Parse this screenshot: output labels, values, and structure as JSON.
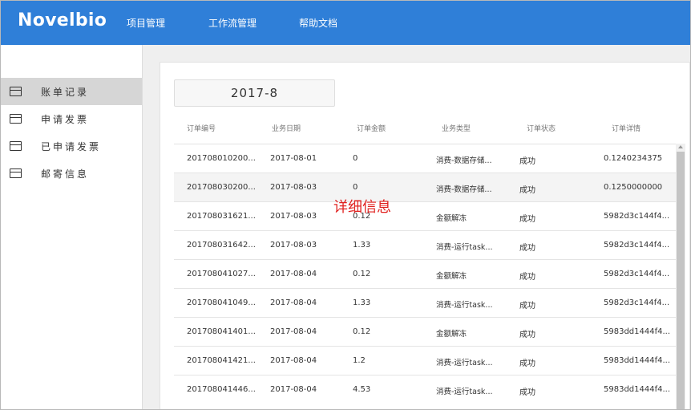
{
  "app": {
    "logo": "Novelbio"
  },
  "nav": {
    "items": [
      "项目管理",
      "工作流管理",
      "帮助文档"
    ]
  },
  "sidebar": {
    "items": [
      {
        "label": "账单记录",
        "icon": "card-icon",
        "active": true
      },
      {
        "label": "申请发票",
        "icon": "card-icon",
        "active": false
      },
      {
        "label": "已申请发票",
        "icon": "card-icon",
        "active": false
      },
      {
        "label": "邮寄信息",
        "icon": "card-icon",
        "active": false
      }
    ]
  },
  "filter": {
    "month": "2017-8"
  },
  "table": {
    "headers": [
      "订单编号",
      "业务日期",
      "订单金额",
      "业务类型",
      "订单状态",
      "订单详情"
    ],
    "rows": [
      [
        "201708010200...",
        "2017-08-01",
        "0",
        "消费-数据存储...",
        "成功",
        "0.1240234375"
      ],
      [
        "201708030200...",
        "2017-08-03",
        "0",
        "消费-数据存储...",
        "成功",
        "0.1250000000"
      ],
      [
        "201708031621...",
        "2017-08-03",
        "0.12",
        "金额解冻",
        "成功",
        "5982d3c144f4..."
      ],
      [
        "201708031642...",
        "2017-08-03",
        "1.33",
        "消费-运行task...",
        "成功",
        "5982d3c144f4..."
      ],
      [
        "201708041027...",
        "2017-08-04",
        "0.12",
        "金额解冻",
        "成功",
        "5982d3c144f4..."
      ],
      [
        "201708041049...",
        "2017-08-04",
        "1.33",
        "消费-运行task...",
        "成功",
        "5982d3c144f4..."
      ],
      [
        "201708041401...",
        "2017-08-04",
        "0.12",
        "金额解冻",
        "成功",
        "5983dd1444f4..."
      ],
      [
        "201708041421...",
        "2017-08-04",
        "1.2",
        "消费-运行task...",
        "成功",
        "5983dd1444f4..."
      ],
      [
        "201708041446...",
        "2017-08-04",
        "4.53",
        "消费-运行task...",
        "成功",
        "5983dd1444f4..."
      ]
    ]
  },
  "overlay": {
    "label": "详细信息",
    "color": "#e0201e"
  },
  "colors": {
    "topbar": "#2f7fd8",
    "sidebar_active": "#d6d6d6",
    "background": "#efefef"
  }
}
